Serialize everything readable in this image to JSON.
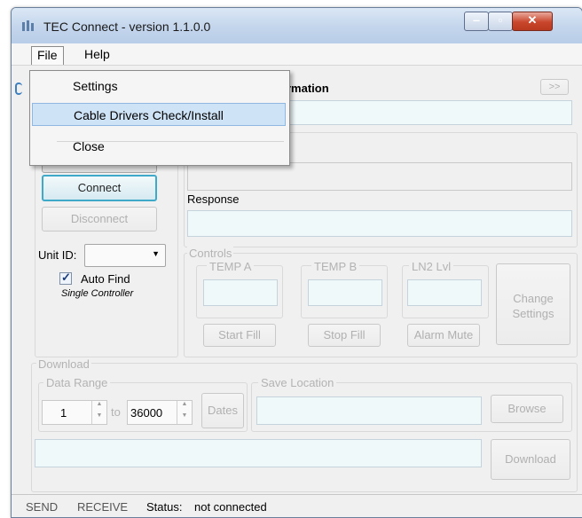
{
  "window": {
    "title": "TEC Connect - version 1.1.0.0"
  },
  "menu": {
    "file": "File",
    "help": "Help"
  },
  "file_menu": {
    "items": [
      "Settings",
      "Cable Drivers Check/Install",
      "Close"
    ],
    "highlighted_index": 1
  },
  "info": {
    "label_partial": "rmation",
    "expand_button": ">>"
  },
  "connection": {
    "connect": "Connect",
    "disconnect": "Disconnect"
  },
  "response": {
    "label": "Response"
  },
  "unit": {
    "label": "Unit ID:",
    "value": "",
    "auto_find_label": "Auto Find",
    "auto_find_checked": true,
    "single_controller": "Single Controller"
  },
  "controls": {
    "group_label": "Controls",
    "temp_a": "TEMP A",
    "temp_b": "TEMP B",
    "ln2": "LN2 Lvl",
    "change_settings": "Change Settings",
    "start_fill": "Start Fill",
    "stop_fill": "Stop Fill",
    "alarm_mute": "Alarm Mute"
  },
  "download": {
    "group_label": "Download",
    "data_range_label": "Data Range",
    "from": "1",
    "to_label": "to",
    "to": "36000",
    "dates": "Dates",
    "save_location_label": "Save Location",
    "browse": "Browse",
    "download_button": "Download"
  },
  "status": {
    "send": "SEND",
    "receive": "RECEIVE",
    "label": "Status:",
    "value": "not connected"
  },
  "colors": {
    "field_tint": "#f0f9fa",
    "focus_border": "#3fa9c9",
    "menu_highlight": "#cfe3f7",
    "close_red": "#c9462c"
  }
}
